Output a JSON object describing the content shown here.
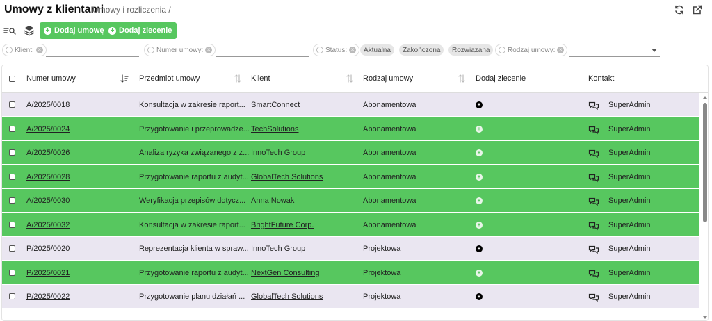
{
  "header": {
    "title": "Umowy z klientami",
    "breadcrumb": "Umowy i rozliczenia /"
  },
  "toolbar": {
    "add_contract_label": "Dodaj umowę",
    "add_order_label": "Dodaj zlecenie"
  },
  "filters": {
    "client_label": "Klient:",
    "contract_number_label": "Numer umowy:",
    "status_label": "Status:",
    "status_options": [
      "Aktualna",
      "Zakończona",
      "Rozwiązana"
    ],
    "contract_type_label": "Rodzaj umowy:"
  },
  "table": {
    "columns": [
      "Numer umowy",
      "Przedmiot umowy",
      "Klient",
      "Rodzaj umowy",
      "Dodaj zlecenie",
      "Kontakt"
    ],
    "rows": [
      {
        "number": "A/2025/0018",
        "subject": "Konsultacja w zakresie raport...",
        "client": "SmartConnect",
        "type": "Abonamentowa",
        "contact": "SuperAdmin",
        "style": "lav"
      },
      {
        "number": "A/2025/0024",
        "subject": "Przygotowanie i przeprowadze...",
        "client": "TechSolutions",
        "type": "Abonamentowa",
        "contact": "SuperAdmin",
        "style": "green"
      },
      {
        "number": "A/2025/0026",
        "subject": "Analiza ryzyka związanego z z...",
        "client": "InnoTech Group",
        "type": "Abonamentowa",
        "contact": "SuperAdmin",
        "style": "green"
      },
      {
        "number": "A/2025/0028",
        "subject": "Przygotowanie raportu z audyt...",
        "client": "GlobalTech Solutions",
        "type": "Abonamentowa",
        "contact": "SuperAdmin",
        "style": "green"
      },
      {
        "number": "A/2025/0030",
        "subject": "Weryfikacja przepisów dotycz...",
        "client": "Anna Nowak",
        "type": "Abonamentowa",
        "contact": "SuperAdmin",
        "style": "green"
      },
      {
        "number": "A/2025/0032",
        "subject": "Konsultacja w zakresie raport...",
        "client": "BrightFuture Corp.",
        "type": "Abonamentowa",
        "contact": "SuperAdmin",
        "style": "green"
      },
      {
        "number": "P/2025/0020",
        "subject": "Reprezentacja klienta w spraw...",
        "client": "InnoTech Group",
        "type": "Projektowa",
        "contact": "SuperAdmin",
        "style": "lav"
      },
      {
        "number": "P/2025/0021",
        "subject": "Przygotowanie raportu z audyt...",
        "client": "NextGen Consulting",
        "type": "Projektowa",
        "contact": "SuperAdmin",
        "style": "green"
      },
      {
        "number": "P/2025/0022",
        "subject": "Przygotowanie planu działań ...",
        "client": "GlobalTech Solutions",
        "type": "Projektowa",
        "contact": "SuperAdmin",
        "style": "lav"
      }
    ]
  },
  "colors": {
    "accent_green": "#57c75f",
    "row_lavender": "#eae6f1"
  },
  "icons": {
    "refresh": "refresh-icon",
    "open_external": "external-link-icon",
    "filter_search": "filter-search-icon",
    "layers": "layers-icon",
    "chat": "chat-icon"
  }
}
